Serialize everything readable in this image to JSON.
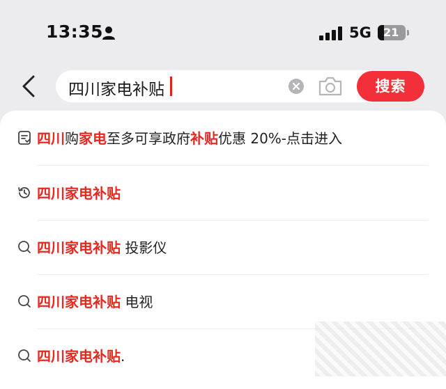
{
  "status_bar": {
    "time": "13:35",
    "network": "5G",
    "battery": "21"
  },
  "search": {
    "query": "四川家电补贴",
    "button_label": "搜索"
  },
  "suggestions": [
    {
      "icon": "coupon-icon",
      "parts": [
        {
          "text": "四川",
          "hl": true
        },
        {
          "text": "购",
          "hl": false
        },
        {
          "text": "家电",
          "hl": true
        },
        {
          "text": "至多可享政府",
          "hl": false
        },
        {
          "text": "补贴",
          "hl": true
        },
        {
          "text": "优惠 20%-点击进入",
          "hl": false
        }
      ]
    },
    {
      "icon": "history-icon",
      "parts": [
        {
          "text": "四川家电补贴",
          "hl": true
        }
      ]
    },
    {
      "icon": "search-icon",
      "parts": [
        {
          "text": "四川家电补贴",
          "hl": true
        },
        {
          "text": " 投影仪",
          "hl": false
        }
      ]
    },
    {
      "icon": "search-icon",
      "parts": [
        {
          "text": "四川家电补贴",
          "hl": true
        },
        {
          "text": " 电视",
          "hl": false
        }
      ]
    },
    {
      "icon": "search-icon",
      "parts": [
        {
          "text": "四川家电补贴",
          "hl": true
        },
        {
          "text": ".",
          "hl": false
        }
      ]
    }
  ],
  "colors": {
    "accent": "#f3303a",
    "highlight": "#e8271f"
  }
}
